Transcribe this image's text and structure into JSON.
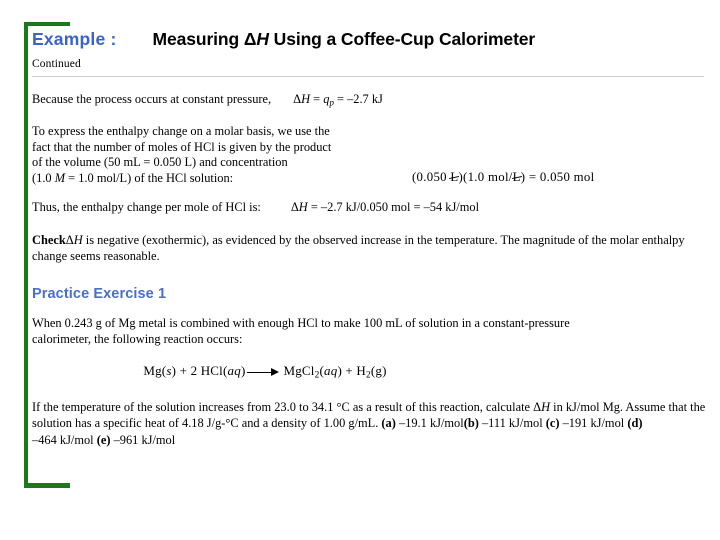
{
  "theme": {
    "accent_green": "#1a7a1a",
    "heading_blue": "#3a63c8",
    "practice_blue": "#4a6fc4",
    "rule_gray": "#cfcfcf"
  },
  "header": {
    "example_label": "Example :",
    "title_prefix": "Measuring Δ",
    "title_italic": "H",
    "title_suffix": " Using a Coffee-Cup Calorimeter",
    "continued_label": "Continued"
  },
  "constant_pressure": {
    "lead_text": "Because the process occurs at constant pressure,",
    "equation_delta": "Δ",
    "equation_h": "H",
    "equation_eq1": " = ",
    "equation_q": "q",
    "equation_sub": "p",
    "equation_rest": " = –2.7 kJ"
  },
  "molar_basis": {
    "line1": "To express the enthalpy change on a molar basis, we use the",
    "line2": "fact that the number of moles of HCl is given by the product",
    "line3": "of the volume (50 mL = 0.050 L) and concentration",
    "line4_pre": "(1.0 ",
    "line4_italic": "M",
    "line4_post": " = 1.0 mol/L) of the HCl solution:",
    "equation_open": "(0.050 ",
    "equation_unit1": "L",
    "equation_mid": ")(1.0 mol/",
    "equation_unit2": "L",
    "equation_close": ")  =  0.050 mol"
  },
  "thus": {
    "lead_text": "Thus, the enthalpy change per mole of HCl is:",
    "equation_delta": "Δ",
    "equation_h": "H",
    "equation_rest": " = –2.7 kJ/0.050 mol = –54 kJ/mol"
  },
  "check": {
    "label": "Check",
    "delta": "Δ",
    "italic_h": "H",
    "body": " is negative (exothermic), as evidenced by the observed increase in the temperature. The magnitude of the molar enthalpy change seems reasonable."
  },
  "practice": {
    "heading": "Practice Exercise 1",
    "question_line1": "When 0.243 g of Mg metal is combined with enough HCl to make 100 mL of solution in a constant-pressure",
    "question_line2": "calorimeter, the following reaction occurs:",
    "reaction": {
      "left_mg": "Mg(",
      "left_mg_state": "s",
      "left_mid": ") + 2 HCl(",
      "left_aq": "aq",
      "left_close": ")",
      "arrow": "⟶",
      "right_mgcl": "MgCl",
      "right_sub": "2",
      "right_open": "(",
      "right_aq": "aq",
      "right_mid": ") + H",
      "right_sub2": "2",
      "right_close": "(g)"
    },
    "final": {
      "part1": "If the temperature of the solution increases from 23.0 to 34.1 °C as a result of this reaction, calculate Δ",
      "italic_h": "H",
      "part2": " in kJ/mol Mg. Assume that the solution has a specific heat of 4.18 J/g-°C and a density of 1.00 g/mL. ",
      "opt_a_label": "(a)",
      "opt_a_value": " –19.1 kJ/mol",
      "opt_b_label": "(b)",
      "opt_b_value": " –111 kJ/mol ",
      "opt_c_label": "(c)",
      "opt_c_value": " –191 kJ/mol ",
      "opt_d_label": "(d)",
      "opt_d_value": " –464 kJ/mol ",
      "opt_e_label": "(e)",
      "opt_e_value": " –961 kJ/mol"
    }
  }
}
